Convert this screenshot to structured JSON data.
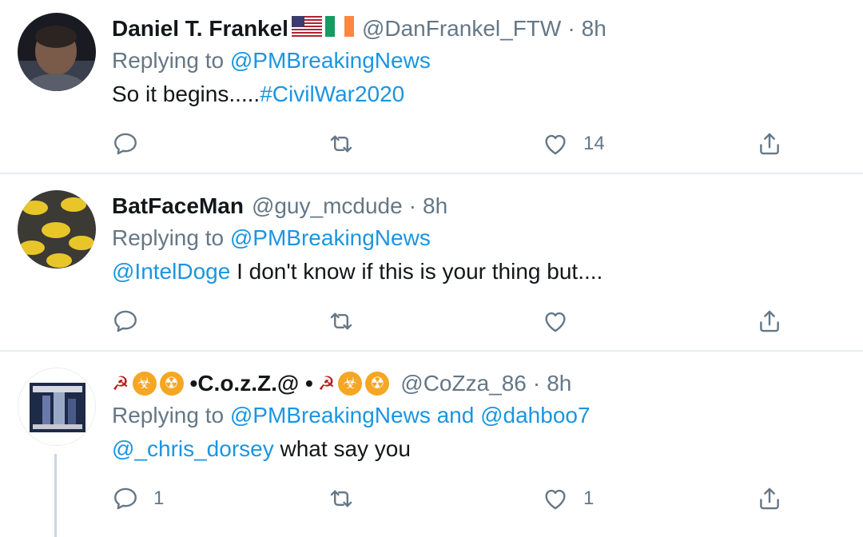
{
  "tweets": [
    {
      "name": "Daniel T. Frankel",
      "handle": "@DanFrankel_FTW",
      "dot": "·",
      "time": "8h",
      "replying_prefix": "Replying to ",
      "replying_to": "@PMBreakingNews",
      "text_plain": "So it begins.....",
      "text_link": "#CivilWar2020",
      "reply_count": "",
      "retweet_count": "",
      "like_count": "14",
      "avatar_color": "#2a2a30"
    },
    {
      "name": "BatFaceMan",
      "handle": "@guy_mcdude",
      "dot": "·",
      "time": "8h",
      "replying_prefix": "Replying to ",
      "replying_to": "@PMBreakingNews",
      "text_link": "@IntelDoge",
      "text_plain": " I don't know if this is your thing but....",
      "reply_count": "",
      "retweet_count": "",
      "like_count": "",
      "avatar_color": "#3a3a36"
    },
    {
      "name": "•C.o.z.Z.@ •",
      "handle": "@CoZza_86",
      "dot": "·",
      "time": "8h",
      "replying_prefix": "Replying to ",
      "replying_to": "@PMBreakingNews",
      "replying_and": " and ",
      "replying_to_2": "@dahboo7",
      "text_link": "@_chris_dorsey",
      "text_plain": " what say you",
      "reply_count": "1",
      "retweet_count": "",
      "like_count": "1",
      "avatar_color": "#1d2a48"
    }
  ],
  "icons": {
    "hammer_sickle": "☭",
    "biohazard": "☣",
    "radioactive": "☢"
  },
  "colors": {
    "link": "#1b95e0",
    "muted": "#657786",
    "text": "#14171a",
    "divider": "#e6ecf0"
  }
}
